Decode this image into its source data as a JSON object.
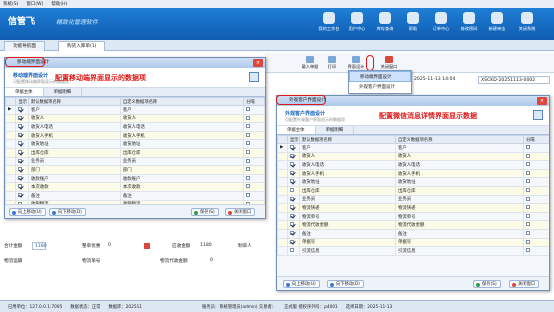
{
  "menubar": {
    "items": [
      "系统(S)",
      "窗口(W)",
      "帮助(H)"
    ]
  },
  "app": {
    "brand": "信管飞",
    "subtitle": "精致化管理软件"
  },
  "toolbar": [
    "我的工作台",
    "用户中心",
    "库存查询",
    "帮助",
    "订单中心",
    "修改密码",
    "新建单击",
    "关闭系统"
  ],
  "tabs": [
    "功能导航面",
    "购货入库单(1)"
  ],
  "bg_buttons": [
    "载入单据",
    "打印",
    "界面设计",
    "关闭窗口"
  ],
  "bg_fields": {
    "date": "2025-11-13 14:04",
    "doc_no": "XSCKD-20251113-0002",
    "total_label": "合计金额",
    "total_value": "1180",
    "discount_label": "整单优惠",
    "discount_value": "0",
    "receivable_label": "应收金额",
    "receivable_value": "1180",
    "maker_label": "制单人",
    "logistics_label": "物流运输",
    "logistics_no_label": "物流单号",
    "collect_label": "物流代收金额",
    "collect_value": "0"
  },
  "dropdown": {
    "items": [
      "移动端界面设计",
      "外观客户界面设计"
    ]
  },
  "dlg_left": {
    "title": "移动端界面设计",
    "head_title": "移动端界面设计",
    "head_sub": "可配置移动端界面显示的数据项",
    "annotation": "配置移动端界面显示的数据项",
    "tabs": [
      "单据主体",
      "单据明细"
    ],
    "columns": [
      "显示",
      "默认数据项名称",
      "自定义数据项名称",
      "分隔"
    ],
    "rows": [
      [
        "客户",
        "客户"
      ],
      [
        "收货人",
        "收货人"
      ],
      [
        "收货人电话",
        "收货人电话"
      ],
      [
        "收货人手机",
        "收货人手机"
      ],
      [
        "收货地址",
        "收货地址"
      ],
      [
        "出库仓库",
        "出库仓库"
      ],
      [
        "业务员",
        "业务员"
      ],
      [
        "部门",
        "部门"
      ],
      [
        "收款账户",
        "收款账户"
      ],
      [
        "本次收款",
        "本次收款"
      ],
      [
        "备注",
        "备注"
      ],
      [
        "收银物流",
        "收银物流"
      ],
      [
        "客户收货人",
        "客户收货人"
      ],
      [
        "单据号",
        "单据号"
      ]
    ],
    "checked": [
      true,
      true,
      true,
      true,
      true,
      true,
      true,
      true,
      true,
      true,
      true,
      false,
      false,
      false
    ],
    "buttons": [
      "向上移动(U)",
      "向下移动(D)",
      "保存(S)",
      "关闭窗口"
    ]
  },
  "dlg_right": {
    "title": "外观客户界面设计",
    "head_title": "外观客户界面设计",
    "head_sub": "可配置外观客户界面显示的数据项",
    "annotation": "配置微信消息详情界面显示数据",
    "tabs": [
      "单据主体",
      "单据明细"
    ],
    "columns": [
      "显示",
      "默认数据项名称",
      "自定义数据项名称",
      "分隔"
    ],
    "rows": [
      [
        "客户",
        "客户"
      ],
      [
        "收货人",
        "收货人"
      ],
      [
        "收货人电话",
        "收货人电话"
      ],
      [
        "收货人手机",
        "收货人手机"
      ],
      [
        "收货地址",
        "收货地址"
      ],
      [
        "出库仓库",
        "出库仓库"
      ],
      [
        "业务员",
        "业务员"
      ],
      [
        "物流快递",
        "物流快递"
      ],
      [
        "物流单号",
        "物流单号"
      ],
      [
        "物流代收金额",
        "物流代收金额"
      ],
      [
        "备注",
        "备注"
      ],
      [
        "单据号",
        "单据号"
      ],
      [
        "引流信息",
        "引流信息"
      ]
    ],
    "checked": [
      true,
      true,
      true,
      true,
      true,
      false,
      true,
      true,
      true,
      true,
      true,
      true,
      false
    ],
    "buttons": [
      "向上移动(U)",
      "向下移动(D)",
      "保存(S)",
      "关闭窗口"
    ]
  },
  "statusbar": {
    "items": [
      "已用单位：127.0.0.1:7095",
      "数据状态：正常",
      "数据库：202511",
      "服务员：系统管理员(admin) 交易者：",
      "正式版  授权序列号：p4001",
      "选择日期：2025-11-13"
    ]
  }
}
